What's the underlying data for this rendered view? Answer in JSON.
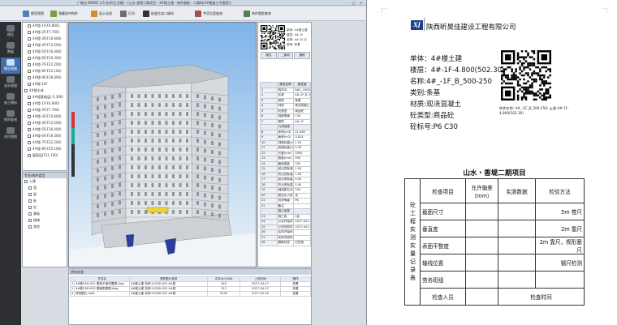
{
  "app": {
    "title": "广联达 BIM5D 3.5 技术(正式版) - [山水·香堤二期项目 - 4#楼土建 - 构件跟踪 - 二维码(4#楼施工平面图)]",
    "toolbar": [
      {
        "label": "模型视图",
        "color": "#4a7fc0"
      },
      {
        "label": "隐藏选中构件",
        "color": "#7d9e3c"
      },
      {
        "label": "显示全部",
        "color": "#d38b2b"
      },
      {
        "label": "打印",
        "color": "#6f6f6f"
      },
      {
        "label": "批量生成二维码",
        "color": "#333333"
      },
      {
        "label": "专项方案查询",
        "color": "#a05050"
      },
      {
        "label": "构件跟踪查询",
        "color": "#508050"
      }
    ],
    "rail": [
      {
        "label": "模型"
      },
      {
        "label": "数据"
      },
      {
        "label": "模型视图"
      },
      {
        "label": "流水视图"
      },
      {
        "label": "施工模拟"
      },
      {
        "label": "物资查询"
      },
      {
        "label": "合约视图"
      }
    ],
    "rail_active_index": 2,
    "tree_items": [
      "4#楼-1F(F4.800)",
      "4#楼-2F(F7.700)",
      "4#楼-3F(F10.600)",
      "4#楼-4F(F13.500)",
      "4#楼-5F(F16.400)",
      "4#楼-6F(F19.300)",
      "4#楼-7F(F22.200)",
      "4#楼-8F(F25.100)",
      "4#楼-9F(F28.000)",
      "4#楼-10F",
      "4#楼主体",
      "4#楼基础层(-5.300)",
      "4#楼-1F(F4.800)",
      "4#楼-2F(F7.700)",
      "4#楼-3F(F10.600)",
      "4#楼-4F(F13.500)",
      "4#楼-5F(F16.400)",
      "4#楼-6F(F19.300)",
      "4#楼-7F(F22.200)",
      "4#楼-8F(F25.100)",
      "屋面层(F31.100)"
    ],
    "layer_panel_title": "专业/构件类型",
    "layer_items": [
      "土建",
      "墙",
      "梁",
      "板",
      "柱",
      "基础",
      "楼梯",
      "其他"
    ],
    "qr_side_lines": [
      "单体: 4#楼土建",
      "楼层: 4#-1F",
      "名称: 4#-1F_B",
      "类别: 条基"
    ],
    "prop_tabs": [
      "属性",
      "二维码",
      "跟踪"
    ],
    "prop_headers": [
      "属性名称",
      "属性值"
    ],
    "prop_rows": [
      [
        "1",
        "构件ID",
        "6#1_100044"
      ],
      [
        "2",
        "名称",
        "4#-1F_B_500"
      ],
      [
        "3",
        "类别",
        "条基"
      ],
      [
        "4",
        "材质",
        "现浇混凝土"
      ],
      [
        "5",
        "砼类型",
        "商品砼"
      ],
      [
        "6",
        "强度等级",
        "C30"
      ],
      [
        "7",
        "楼层",
        "4#-1F"
      ],
      [
        "",
        "几何信息",
        ""
      ],
      [
        "8",
        "体积(m3)",
        "11.569"
      ],
      [
        "9",
        "面积(m2)",
        "3.814"
      ],
      [
        "10",
        "顶面标高(m)",
        "1.05"
      ],
      [
        "11",
        "底面标高(m)",
        "0.00"
      ],
      [
        "12",
        "长度(mm)",
        "2500"
      ],
      [
        "13",
        "宽度(mm)",
        "500"
      ],
      [
        "14",
        "截面高度",
        "250"
      ],
      [
        "15",
        "起点顶标高",
        "1.05"
      ],
      [
        "16",
        "终点顶标高",
        "1.05"
      ],
      [
        "17",
        "起点底标高",
        "0.00"
      ],
      [
        "18",
        "终点底标高",
        "0.00"
      ],
      [
        "19",
        "轴线距左边线",
        "250"
      ],
      [
        "20",
        "是否为人防",
        "否"
      ],
      [
        "21",
        "抗渗等级",
        "P6"
      ],
      [
        "22",
        "备注",
        ""
      ],
      [
        "",
        "施工信息",
        ""
      ],
      [
        "23",
        "施工段",
        "1区"
      ],
      [
        "24",
        "计划开始时间",
        "2017-04-12"
      ],
      [
        "25",
        "计划完成时间",
        "2017-04-17"
      ],
      [
        "26",
        "实际开始时间",
        ""
      ],
      [
        "27",
        "实际完成时间",
        ""
      ],
      [
        "28",
        "跟踪状态",
        "已完成"
      ]
    ],
    "bottom_title": "资料信息",
    "bottom_headers": [
      "",
      "文件名",
      "关联图元名称",
      "文件大小(KB)",
      "上传时间",
      "操作"
    ],
    "bottom_rows": [
      [
        "1",
        "4#楼CAD-001 基础平面布置图.dwg",
        "4#楼土建 名称:4-DQS-001 4#楼",
        "349",
        "2017-04-17",
        "查看"
      ],
      [
        "2",
        "4#楼CAD-002 基础配筋图.dwg",
        "4#楼土建 名称:4-DQS-001 4#楼",
        "312",
        "2017-04-17",
        "查看"
      ],
      [
        "3",
        "现场图片.mp4",
        "4#楼土建 名称:4-DQS-001 4#楼",
        "5550",
        "2017-05-20",
        "查看"
      ]
    ]
  },
  "doc": {
    "logo_text": "XJ",
    "company": "陕西昕昊佳建设工程有限公司",
    "lines": [
      "单体：4#楼土建",
      "楼层：4#-1F-4.800(502.30)",
      "名称:4#_-1F_B_500-250",
      "类别:条基",
      "材质:现浇混凝土",
      "砼类型:商品砼",
      "砼标号:P6 C30"
    ],
    "qr_caption": "构件名称: 4#_-1F_B_500-250; 土建-4#-1F-4.800(502.30)",
    "project_title": "山水・香堤二期项目",
    "form_side_label": "砼工程实测实量记录表",
    "form_headers": [
      "检查项目",
      "允许偏差（mm）",
      "实测数据",
      "检验方法"
    ],
    "form_rows": [
      [
        "截面尺寸",
        "",
        "",
        "5m 卷尺"
      ],
      [
        "垂直度",
        "",
        "",
        "2m 靠尺"
      ],
      [
        "表面平整度",
        "",
        "",
        "2m 靠尺，楔形塞尺"
      ],
      [
        "轴线位置",
        "",
        "",
        "钢尺检测"
      ],
      [
        "劳务班组",
        "",
        "",
        ""
      ]
    ],
    "footer_labels": [
      "检查人员",
      "检查时间"
    ]
  },
  "colors": {
    "rail_bg": "#2d2f33",
    "rail_active": "#3e6fb0",
    "logo_blue": "#1f3f8f",
    "sky_top": "#7fb3e8"
  },
  "icons": [
    "window-minimize-icon",
    "window-maximize-icon",
    "window-close-icon",
    "building-model",
    "qr-code"
  ]
}
